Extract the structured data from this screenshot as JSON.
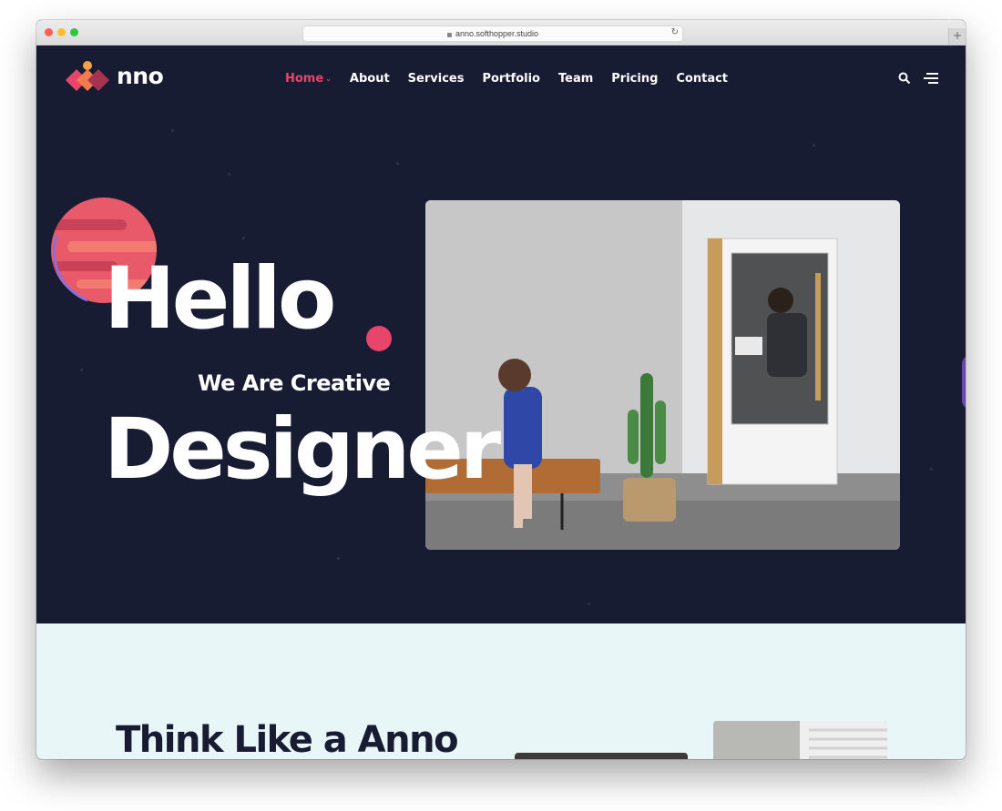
{
  "browser": {
    "url": "anno.softhopper.studio"
  },
  "header": {
    "logo_text": "nno",
    "nav": [
      {
        "label": "Home",
        "active": true
      },
      {
        "label": "About"
      },
      {
        "label": "Services"
      },
      {
        "label": "Portfolio"
      },
      {
        "label": "Team"
      },
      {
        "label": "Pricing"
      },
      {
        "label": "Contact"
      }
    ],
    "icons": [
      "search-icon",
      "menu-icon"
    ]
  },
  "hero": {
    "title": "Hello",
    "subtitle": "We Are Creative",
    "title2": "Designer"
  },
  "section2": {
    "title": "Think Like a Anno"
  },
  "colors": {
    "background": "#171c33",
    "accent": "#e8456b",
    "section_bg": "#e9f6f7"
  }
}
